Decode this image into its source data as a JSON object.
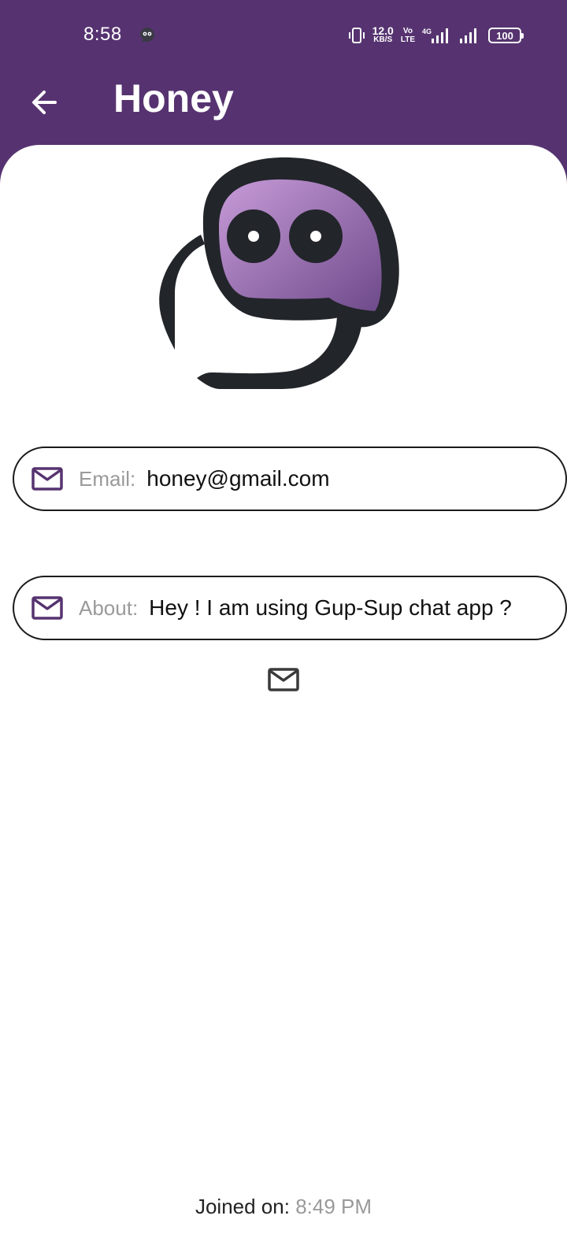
{
  "status_bar": {
    "time": "8:58",
    "net_speed_value": "12.0",
    "net_speed_unit": "KB/S",
    "volte_top": "Vo",
    "volte_bottom": "LTE",
    "network": "4G",
    "battery": "100",
    "icons": [
      "app-chat-icon",
      "vibrate-icon",
      "signal-icon",
      "signal-icon",
      "battery-icon"
    ]
  },
  "app_bar": {
    "back_icon": "arrow-left-icon",
    "title": "Honey"
  },
  "profile": {
    "avatar_icon": "gup-sup-logo",
    "email_label": "Email:",
    "email_value": "honey@gmail.com",
    "about_label": "About:",
    "about_value": "Hey ! I am using Gup-Sup chat app ?",
    "field_icon": "mail-icon",
    "joined_label": "Joined on:",
    "joined_value": "8:49 PM"
  },
  "colors": {
    "primary": "#563370",
    "logo_gradient_start": "#c79bd8",
    "logo_gradient_end": "#6e4a8a",
    "logo_outline": "#22252a"
  }
}
